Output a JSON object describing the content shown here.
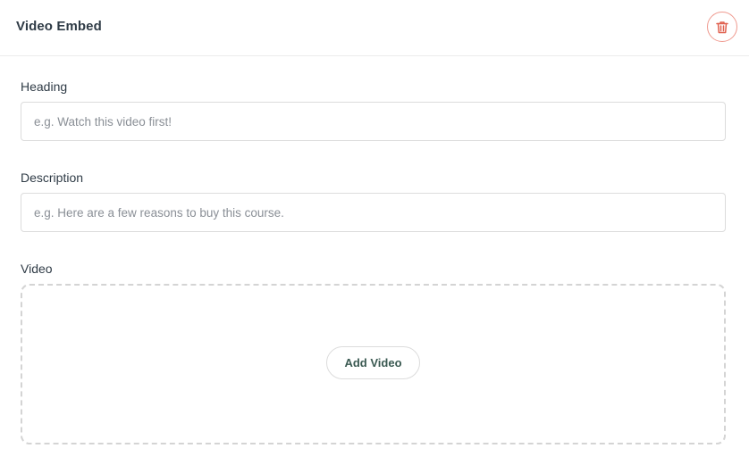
{
  "header": {
    "title": "Video Embed",
    "delete_icon": "trash-icon",
    "delete_color": "#e0604e"
  },
  "fields": {
    "heading": {
      "label": "Heading",
      "value": "",
      "placeholder": "e.g. Watch this video first!"
    },
    "description": {
      "label": "Description",
      "value": "",
      "placeholder": "e.g. Here are a few reasons to buy this course."
    },
    "video": {
      "label": "Video",
      "add_button_label": "Add Video"
    }
  }
}
